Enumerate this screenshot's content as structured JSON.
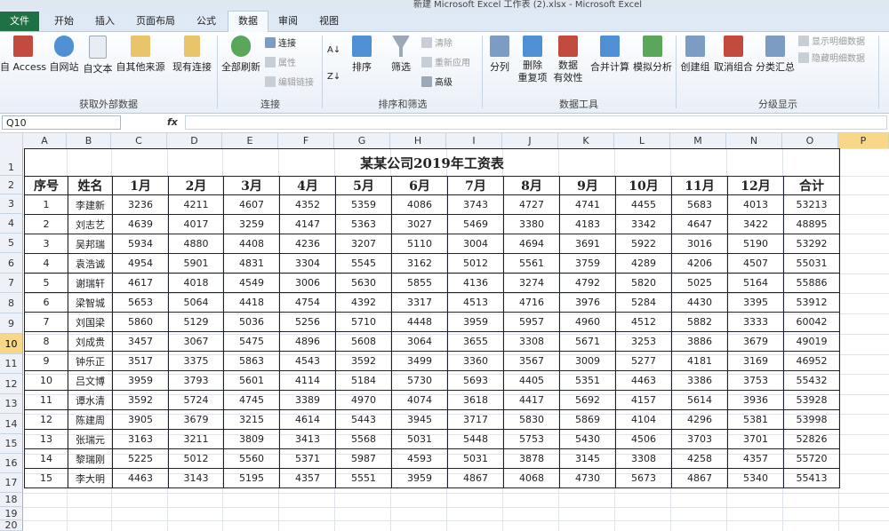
{
  "window": {
    "title": "新建 Microsoft Excel 工作表 (2).xlsx - Microsoft Excel"
  },
  "tabs": [
    "文件",
    "开始",
    "插入",
    "页面布局",
    "公式",
    "数据",
    "审阅",
    "视图"
  ],
  "active_tab": "数据",
  "ribbon": {
    "external": {
      "label": "获取外部数据",
      "access": "自 Access",
      "web": "自网站",
      "text": "自文本",
      "other": "自其他来源",
      "existing": "现有连接"
    },
    "connections": {
      "label": "连接",
      "refresh_all": "全部刷新",
      "connections": "连接",
      "properties": "属性",
      "edit_links": "编辑链接"
    },
    "sort_filter": {
      "label": "排序和筛选",
      "sort": "排序",
      "filter": "筛选",
      "clear": "清除",
      "reapply": "重新应用",
      "advanced": "高级"
    },
    "data_tools": {
      "label": "数据工具",
      "split": "分列",
      "remove_dup_1": "删除",
      "remove_dup_2": "重复项",
      "validation_1": "数据",
      "validation_2": "有效性",
      "consolidate": "合并计算",
      "what_if": "模拟分析"
    },
    "outline": {
      "label": "分级显示",
      "group": "创建组",
      "ungroup": "取消组合",
      "subtotal": "分类汇总",
      "show_detail": "显示明细数据",
      "hide_detail": "隐藏明细数据"
    }
  },
  "name_box": "Q10",
  "fx_label": "fx",
  "columns": [
    "A",
    "B",
    "C",
    "D",
    "E",
    "F",
    "G",
    "H",
    "I",
    "J",
    "K",
    "L",
    "M",
    "N",
    "O",
    "P"
  ],
  "rows": [
    "1",
    "2",
    "3",
    "4",
    "5",
    "6",
    "7",
    "8",
    "9",
    "10",
    "11",
    "12",
    "13",
    "14",
    "15",
    "16",
    "17",
    "18",
    "19",
    "20"
  ],
  "selected_row": "10",
  "sheet": {
    "title": "某某公司2019年工资表",
    "headers": [
      "序号",
      "姓名",
      "1月",
      "2月",
      "3月",
      "4月",
      "5月",
      "6月",
      "7月",
      "8月",
      "9月",
      "10月",
      "11月",
      "12月",
      "合计"
    ],
    "records": [
      [
        "1",
        "李建新",
        "3236",
        "4211",
        "4607",
        "4352",
        "5359",
        "4086",
        "3743",
        "4727",
        "4741",
        "4455",
        "5683",
        "4013",
        "53213"
      ],
      [
        "2",
        "刘志艺",
        "4639",
        "4017",
        "3259",
        "4147",
        "5363",
        "3027",
        "5469",
        "3380",
        "4183",
        "3342",
        "4647",
        "3422",
        "48895"
      ],
      [
        "3",
        "吴邦瑞",
        "5934",
        "4880",
        "4408",
        "4236",
        "3207",
        "5110",
        "3004",
        "4694",
        "3691",
        "5922",
        "3016",
        "5190",
        "53292"
      ],
      [
        "4",
        "袁浩诚",
        "4954",
        "5901",
        "4831",
        "3304",
        "5545",
        "3162",
        "5012",
        "5561",
        "3759",
        "4289",
        "4206",
        "4507",
        "55031"
      ],
      [
        "5",
        "谢瑞轩",
        "4617",
        "4018",
        "4549",
        "3006",
        "5630",
        "5855",
        "4136",
        "3274",
        "4792",
        "5820",
        "5025",
        "5164",
        "55886"
      ],
      [
        "6",
        "梁智城",
        "5653",
        "5064",
        "4418",
        "4754",
        "4392",
        "3317",
        "4513",
        "4716",
        "3976",
        "5284",
        "4430",
        "3395",
        "53912"
      ],
      [
        "7",
        "刘国梁",
        "5860",
        "5129",
        "5036",
        "5256",
        "5710",
        "4448",
        "3959",
        "5957",
        "4960",
        "4512",
        "5882",
        "3333",
        "60042"
      ],
      [
        "8",
        "刘成贵",
        "3457",
        "3067",
        "5475",
        "4896",
        "5608",
        "3064",
        "3655",
        "3308",
        "5671",
        "3253",
        "3886",
        "3679",
        "49019"
      ],
      [
        "9",
        "钟乐正",
        "3517",
        "3375",
        "5863",
        "4543",
        "3592",
        "3499",
        "3360",
        "3567",
        "3009",
        "5277",
        "4181",
        "3169",
        "46952"
      ],
      [
        "10",
        "吕文博",
        "3959",
        "3793",
        "5601",
        "4114",
        "5184",
        "5730",
        "5693",
        "4405",
        "5351",
        "4463",
        "3386",
        "3753",
        "55432"
      ],
      [
        "11",
        "谭水清",
        "3592",
        "5724",
        "4745",
        "3389",
        "4970",
        "4074",
        "3618",
        "4417",
        "5692",
        "4157",
        "5614",
        "3936",
        "53928"
      ],
      [
        "12",
        "陈建周",
        "3905",
        "3679",
        "3215",
        "4614",
        "5443",
        "3945",
        "3717",
        "5830",
        "5869",
        "4104",
        "4296",
        "5381",
        "53998"
      ],
      [
        "13",
        "张瑞元",
        "3163",
        "3211",
        "3809",
        "3413",
        "5568",
        "5031",
        "5448",
        "5753",
        "5430",
        "4506",
        "3703",
        "3701",
        "52826"
      ],
      [
        "14",
        "黎瑞刚",
        "5225",
        "5012",
        "5560",
        "5371",
        "5987",
        "4593",
        "5031",
        "3878",
        "3145",
        "3308",
        "4258",
        "4357",
        "55720"
      ],
      [
        "15",
        "李大明",
        "4463",
        "3143",
        "5195",
        "4357",
        "5551",
        "3959",
        "4867",
        "4068",
        "4730",
        "5673",
        "4867",
        "5340",
        "55413"
      ]
    ]
  },
  "colors": {
    "file_tab": "#1e7145",
    "selected": "#f8d789",
    "ribbon": "#e9eff7"
  }
}
